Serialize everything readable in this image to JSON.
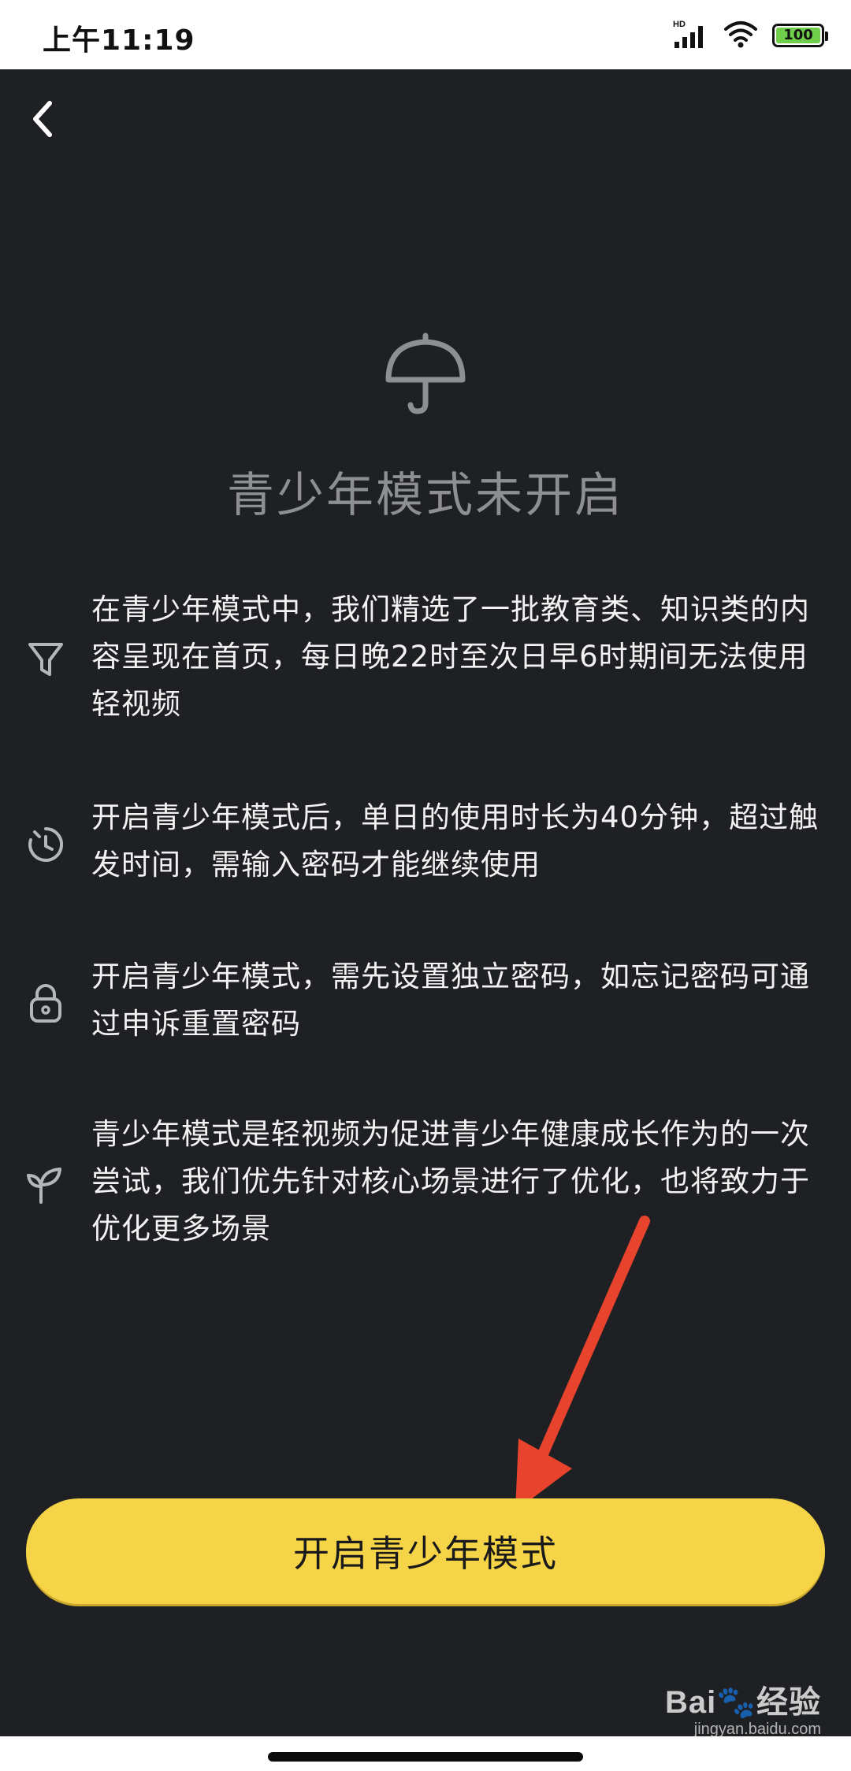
{
  "status_bar": {
    "time": "上午11:19",
    "network_label": "HD",
    "battery_level": "100",
    "colors": {
      "battery_fill": "#6fcf4a"
    }
  },
  "header": {
    "back_icon": "chevron-left-icon"
  },
  "main": {
    "hero_icon": "umbrella-icon",
    "title": "青少年模式未开启",
    "features": [
      {
        "icon": "filter-funnel-icon",
        "text": "在青少年模式中，我们精选了一批教育类、知识类的内容呈现在首页，每日晚22时至次日早6时期间无法使用轻视频"
      },
      {
        "icon": "timer-icon",
        "text": "开启青少年模式后，单日的使用时长为40分钟，超过触发时间，需输入密码才能继续使用"
      },
      {
        "icon": "lock-icon",
        "text": "开启青少年模式，需先设置独立密码，如忘记密码可通过申诉重置密码"
      },
      {
        "icon": "sprout-icon",
        "text": "青少年模式是轻视频为促进青少年健康成长作为的一次尝试，我们优先针对核心场景进行了优化，也将致力于优化更多场景"
      }
    ]
  },
  "cta": {
    "label": "开启青少年模式",
    "color": "#f6d447"
  },
  "annotation": {
    "arrow_color": "#e8432d"
  },
  "watermark": {
    "main": "Bai🐾经验",
    "sub": "jingyan.baidu.com"
  }
}
